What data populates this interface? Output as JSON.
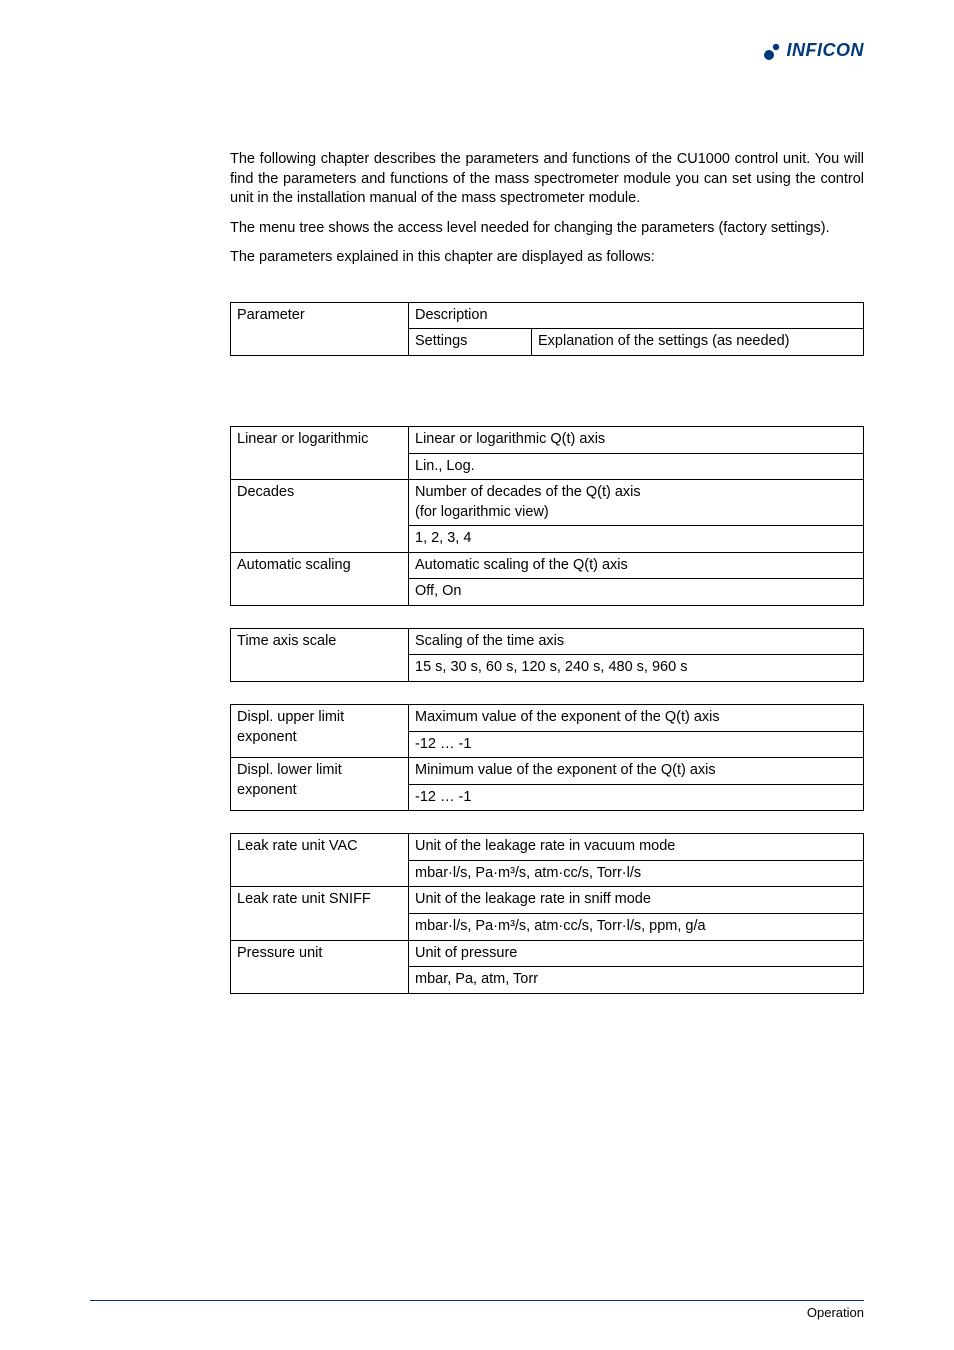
{
  "logo": {
    "text": "INFICON"
  },
  "intro": {
    "p1": "The following chapter describes the parameters and functions of the CU1000 control unit. You will find the parameters and functions of the mass spectrometer module you can set using the control unit in the installation manual of the mass spectrometer module.",
    "p2": "The menu tree shows the access level needed for changing the parameters (factory settings).",
    "p3": "The parameters explained in this chapter are displayed as follows:"
  },
  "table_key": {
    "parameter": "Parameter",
    "description": "Description",
    "settings": "Settings",
    "explanation": "Explanation of the settings (as needed)"
  },
  "table_qt_axis": {
    "r0_param": "Linear or logarithmic",
    "r0_desc": "Linear or logarithmic Q(t) axis",
    "r0_settings": "Lin., Log.",
    "r1_param": "Decades",
    "r1_desc": "Number of decades of the Q(t) axis\n(for logarithmic view)",
    "r1_settings": "1, 2, 3, 4",
    "r2_param": "Automatic scaling",
    "r2_desc": "Automatic scaling of the Q(t) axis",
    "r2_settings": "Off, On"
  },
  "table_time_axis": {
    "param": "Time axis scale",
    "desc": "Scaling of the time axis",
    "settings": "15 s, 30 s, 60 s, 120 s, 240 s, 480 s, 960 s"
  },
  "table_displ": {
    "r0_param": "Displ. upper limit exponent",
    "r0_desc": "Maximum value of the exponent of the Q(t) axis",
    "r0_settings": "-12 … -1",
    "r1_param": "Displ. lower limit exponent",
    "r1_desc": "Minimum value of the exponent of the Q(t) axis",
    "r1_settings": "-12 … -1"
  },
  "table_units": {
    "r0_param": "Leak rate unit VAC",
    "r0_desc": "Unit of the leakage rate in vacuum mode",
    "r0_settings": "mbar·l/s, Pa·m³/s, atm·cc/s, Torr·l/s",
    "r1_param": "Leak rate unit SNIFF",
    "r1_desc": "Unit of the leakage rate in sniff mode",
    "r1_settings": "mbar·l/s, Pa·m³/s, atm·cc/s, Torr·l/s, ppm, g/a",
    "r2_param": "Pressure unit",
    "r2_desc": "Unit of pressure",
    "r2_settings": "mbar, Pa, atm, Torr"
  },
  "footer": {
    "text": "Operation"
  }
}
